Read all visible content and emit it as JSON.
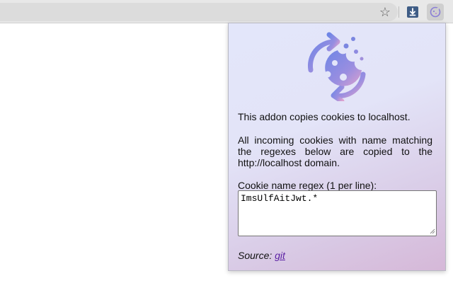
{
  "browser": {
    "bookmark_icon": "star-icon",
    "extensions": [
      {
        "name": "download-extension",
        "icon": "download-icon",
        "color": "#3f5d86"
      },
      {
        "name": "cookie-extension",
        "icon": "cookie-icon",
        "color": "#8a7fd6"
      }
    ]
  },
  "popup": {
    "logo_icon": "cookie-sync-icon",
    "intro": "This addon copies cookies to localhost.",
    "description": "All incoming cookies with name matching the regexes below are copied to the http://localhost domain.",
    "regex_label": "Cookie name regex (1 per line):",
    "regex_value": "ImsUlfAitJwt.*",
    "source_label": "Source:",
    "source_link": "git"
  },
  "colors": {
    "accent": "#7b86e0",
    "accent_pink": "#d59bd0",
    "link": "#5a1fa3"
  }
}
